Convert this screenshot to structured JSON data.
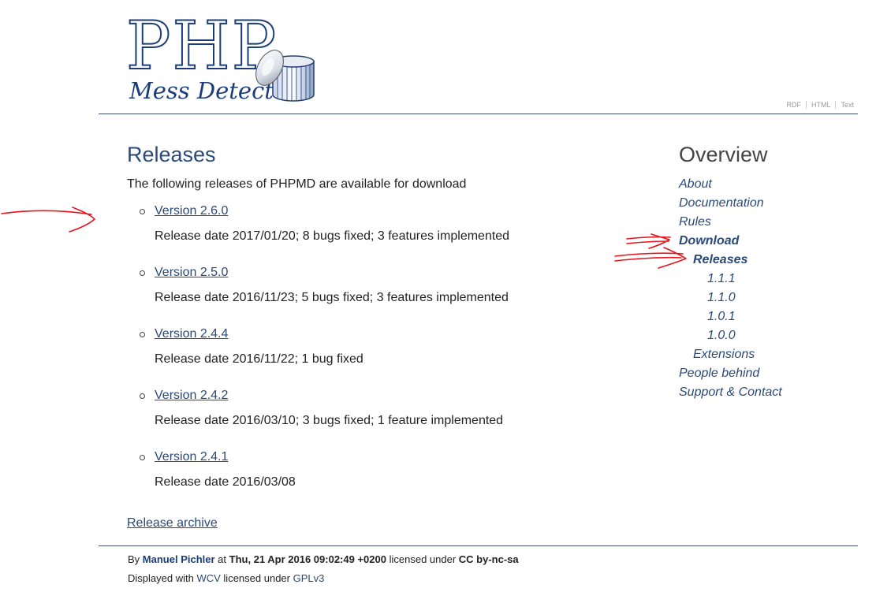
{
  "header": {
    "logo_title": "PHP",
    "logo_subtitle": "Mess Detector",
    "format_links": [
      "RDF",
      "HTML",
      "Text"
    ]
  },
  "main": {
    "title": "Releases",
    "intro": "The following releases of PHPMD are available for download",
    "releases": [
      {
        "label": "Version 2.6.0",
        "description": "Release date 2017/01/20; 8 bugs fixed; 3 features implemented"
      },
      {
        "label": "Version 2.5.0",
        "description": "Release date 2016/11/23; 5 bugs fixed; 3 features implemented"
      },
      {
        "label": "Version 2.4.4",
        "description": "Release date 2016/11/22; 1 bug fixed"
      },
      {
        "label": "Version 2.4.2",
        "description": "Release date 2016/03/10; 3 bugs fixed; 1 feature implemented"
      },
      {
        "label": "Version 2.4.1",
        "description": "Release date 2016/03/08"
      }
    ],
    "archive_link": "Release archive"
  },
  "sidebar": {
    "title": "Overview",
    "items": [
      {
        "label": "About"
      },
      {
        "label": "Documentation"
      },
      {
        "label": "Rules"
      },
      {
        "label": "Download"
      },
      {
        "label": "Releases"
      },
      {
        "label": "1.1.1"
      },
      {
        "label": "1.1.0"
      },
      {
        "label": "1.0.1"
      },
      {
        "label": "1.0.0"
      },
      {
        "label": "Extensions"
      },
      {
        "label": "People behind"
      },
      {
        "label": "Support & Contact"
      }
    ]
  },
  "footer": {
    "by": "By",
    "author": "Manuel Pichler",
    "at": "at",
    "date": "Thu, 21 Apr 2016 09:02:49 +0200",
    "licensed_under": "licensed under",
    "license": "CC by-nc-sa",
    "displayed_with": "Displayed with",
    "wcv": "WCV",
    "licensed_under_2": "licensed under",
    "gpl": "GPLv3"
  },
  "colors": {
    "link": "#2a4a7a",
    "logo": "#1a3d7a",
    "annotation": "#e8141b"
  }
}
